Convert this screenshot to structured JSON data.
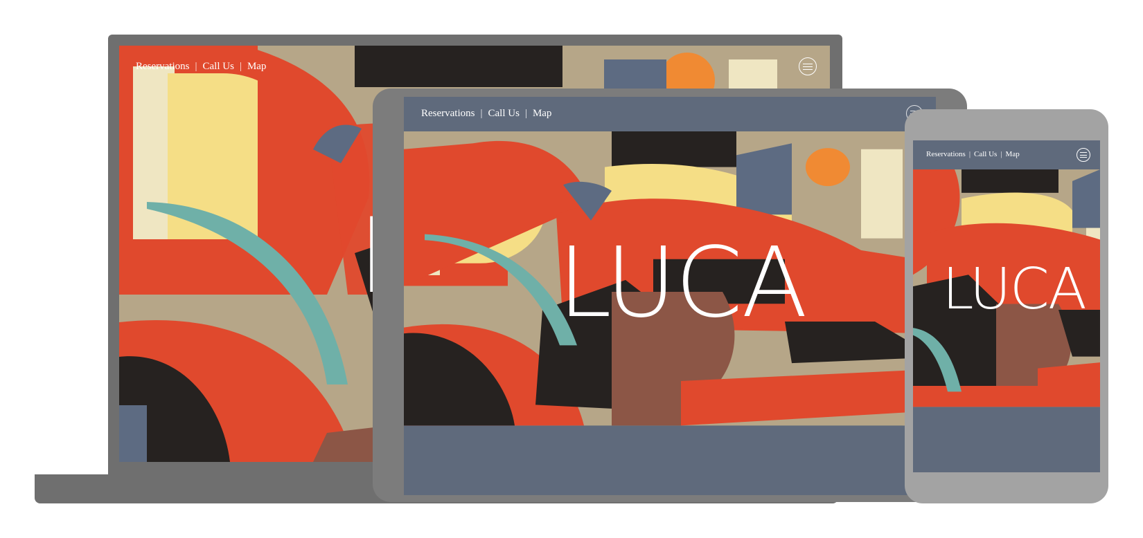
{
  "brand": {
    "name": "LUCA"
  },
  "nav": {
    "reservations": "Reservations",
    "call_us": "Call Us",
    "map": "Map",
    "separator": "|"
  },
  "colors": {
    "device_dark": "#6f6f6f",
    "device_mid": "#7c7c7c",
    "device_light": "#a3a3a3",
    "header_band": "#5f6a7c",
    "art_red": "#e0492d",
    "art_cream": "#efe6c2",
    "art_yellow": "#f5de86",
    "art_teal": "#6fb0a8",
    "art_black": "#262220",
    "art_tan": "#b6a688",
    "art_slate": "#5d6b82",
    "art_orange": "#f08a33",
    "art_brown": "#8c5646"
  },
  "icons": {
    "menu": "hamburger-circle-icon"
  },
  "devices": [
    "laptop",
    "tablet",
    "phone"
  ]
}
